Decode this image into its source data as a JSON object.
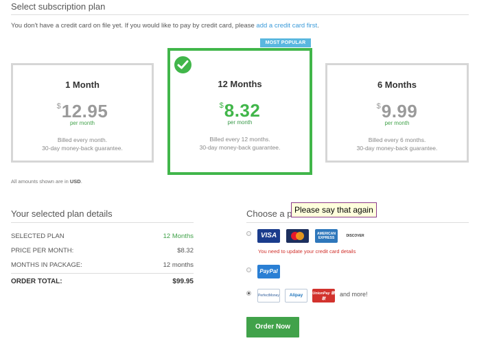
{
  "header": {
    "title": "Select subscription plan",
    "notice_text": "You don't have a credit card on file yet. If you would like to pay by credit card, please",
    "notice_link": "add a credit card first",
    "notice_end": "."
  },
  "badge": "MOST POPULAR",
  "plans": [
    {
      "name": "1 Month",
      "currency": "$",
      "price": "12.95",
      "per": "per month",
      "billed_1": "Billed every month.",
      "billed_2": "30-day money-back guarantee.",
      "selected": false
    },
    {
      "name": "12 Months",
      "currency": "$",
      "price": "8.32",
      "per": "per month",
      "billed_1": "Billed every 12 months.",
      "billed_2": "30-day money-back guarantee.",
      "selected": true
    },
    {
      "name": "6 Months",
      "currency": "$",
      "price": "9.99",
      "per": "per month",
      "billed_1": "Billed every 6 months.",
      "billed_2": "30-day money-back guarantee.",
      "selected": false
    }
  ],
  "amounts_note_text": "All amounts shown are in",
  "amounts_note_currency": "USD",
  "amounts_note_end": ".",
  "details": {
    "title": "Your selected plan details",
    "rows": [
      {
        "label": "SELECTED PLAN",
        "value": "12 Months"
      },
      {
        "label": "PRICE PER MONTH:",
        "value": "$8.32"
      },
      {
        "label": "MONTHS IN PACKAGE:",
        "value": "12 months"
      }
    ],
    "total_label": "ORDER TOTAL:",
    "total_value": "$99.95"
  },
  "payment": {
    "title": "Choose a p",
    "cards": {
      "visa": "VISA",
      "mastercard": "MasterCard",
      "amex": "AMERICAN EXPRESS",
      "discover": "DISCOVER"
    },
    "card_warning": "You need to update your credit card details",
    "paypal": "PayPal",
    "alt": {
      "perfectmoney": "PerfectMoney",
      "alipay": "Alipay",
      "unionpay": "UnionPay 银联"
    },
    "and_more": "and more!",
    "selected_method": "alternative"
  },
  "order_button": "Order Now",
  "tooltip": "Please say that again",
  "colors": {
    "accent_green": "#41b64a",
    "badge_blue": "#5ab7df",
    "link_blue": "#3a9ad9",
    "warning_red": "#d0302b"
  }
}
